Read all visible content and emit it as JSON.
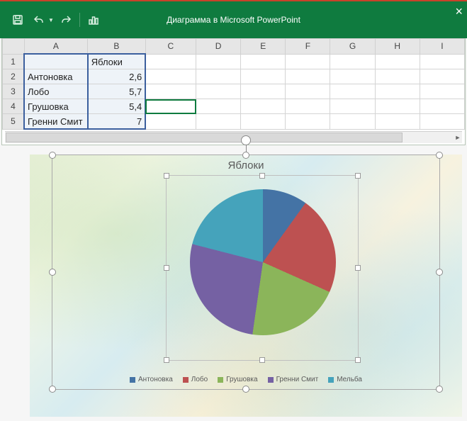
{
  "app": {
    "title": "Диаграмма в Microsoft PowerPoint"
  },
  "sheet": {
    "columns": [
      "A",
      "B",
      "C",
      "D",
      "E",
      "F",
      "G",
      "H",
      "I"
    ],
    "header_label": "Яблоки",
    "rows": [
      {
        "n": "1",
        "a": "",
        "b": "Яблоки"
      },
      {
        "n": "2",
        "a": "Антоновка",
        "b": "2,6"
      },
      {
        "n": "3",
        "a": "Лобо",
        "b": "5,7"
      },
      {
        "n": "4",
        "a": "Грушовка",
        "b": "5,4"
      },
      {
        "n": "5",
        "a": "Гренни Смит",
        "b": "7"
      }
    ],
    "active_cell": "C4"
  },
  "chart_data": {
    "type": "pie",
    "title": "Яблоки",
    "series": [
      {
        "name": "Антоновка",
        "value": 2.6,
        "color": "#4473a5"
      },
      {
        "name": "Лобо",
        "value": 5.7,
        "color": "#bd5151"
      },
      {
        "name": "Грушовка",
        "value": 5.4,
        "color": "#8bb55a"
      },
      {
        "name": "Гренни Смит",
        "value": 7,
        "color": "#7561a3"
      },
      {
        "name": "Мельба",
        "value": 5.5,
        "color": "#45a3bb"
      }
    ]
  }
}
